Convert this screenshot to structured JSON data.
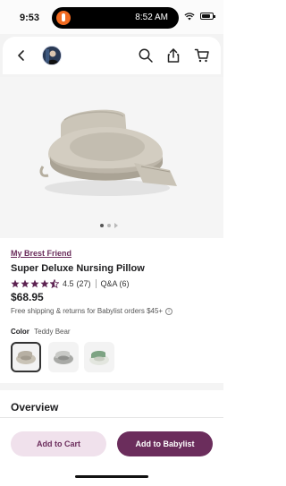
{
  "status_bar": {
    "time": "9:53",
    "island_time": "8:52 AM"
  },
  "header": {
    "back_icon": "chevron-left-icon",
    "search_icon": "search-icon",
    "share_icon": "share-icon",
    "cart_icon": "cart-icon"
  },
  "product": {
    "brand": "My Brest Friend",
    "title": "Super Deluxe Nursing Pillow",
    "rating": "4.5",
    "review_count": "(27)",
    "qa": "Q&A (6)",
    "price": "$68.95",
    "shipping": "Free shipping & returns for Babylist orders $45+",
    "color_label": "Color",
    "color_value": "Teddy Bear"
  },
  "swatches": [
    "Teddy Bear",
    "Gray",
    "Green"
  ],
  "overview_title": "Overview",
  "actions": {
    "add_to_cart": "Add to Cart",
    "add_to_babylist": "Add to Babylist"
  },
  "colors": {
    "brand_plum": "#6b2d5c",
    "cart_button_bg": "#f0e1ec"
  }
}
